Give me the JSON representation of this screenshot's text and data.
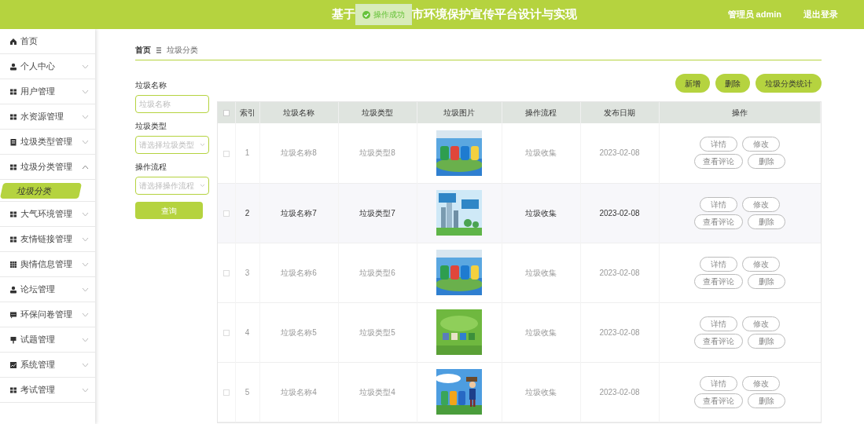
{
  "header": {
    "title_start": "基于",
    "toast": "操作成功",
    "title_end": "市环境保护宣传平台设计与实现",
    "user": "管理员 admin",
    "logout": "退出登录"
  },
  "sidebar": {
    "items": [
      {
        "label": "首页",
        "kind": "link"
      },
      {
        "label": "个人中心",
        "kind": "group",
        "expanded": false
      },
      {
        "label": "用户管理",
        "kind": "group",
        "expanded": false
      },
      {
        "label": "水资源管理",
        "kind": "group",
        "expanded": false
      },
      {
        "label": "垃圾类型管理",
        "kind": "group",
        "expanded": false
      },
      {
        "label": "垃圾分类管理",
        "kind": "group",
        "expanded": true,
        "children": [
          {
            "label": "垃圾分类",
            "selected": true
          }
        ]
      },
      {
        "label": "大气环境管理",
        "kind": "group",
        "expanded": false
      },
      {
        "label": "友情链接管理",
        "kind": "group",
        "expanded": false
      },
      {
        "label": "舆情信息管理",
        "kind": "group",
        "expanded": false
      },
      {
        "label": "论坛管理",
        "kind": "group",
        "expanded": false
      },
      {
        "label": "环保问卷管理",
        "kind": "group",
        "expanded": false
      },
      {
        "label": "试题管理",
        "kind": "group",
        "expanded": false
      },
      {
        "label": "系统管理",
        "kind": "group",
        "expanded": false
      },
      {
        "label": "考试管理",
        "kind": "group",
        "expanded": false
      }
    ]
  },
  "breadcrumb": [
    "首页",
    "垃圾分类"
  ],
  "filters": [
    {
      "label": "垃圾名称",
      "kind": "input",
      "placeholder": "垃圾名称"
    },
    {
      "label": "垃圾类型",
      "kind": "select",
      "placeholder": "请选择垃圾类型"
    },
    {
      "label": "操作流程",
      "kind": "select",
      "placeholder": "请选择操作流程"
    }
  ],
  "search_button": "查询",
  "actions": [
    "新增",
    "删除",
    "垃圾分类统计"
  ],
  "table": {
    "all_checked": false,
    "columns": [
      "索引",
      "垃圾名称",
      "垃圾类型",
      "垃圾图片",
      "操作流程",
      "发布日期",
      "操作"
    ],
    "rows": [
      {
        "checked": false,
        "highlighted": false,
        "index": "1",
        "name": "垃圾名称8",
        "type": "垃圾类型8",
        "process": "垃圾收集",
        "date": "2023-02-08",
        "ops": [
          "详情",
          "修改",
          "查看评论",
          "删除"
        ]
      },
      {
        "checked": false,
        "highlighted": true,
        "index": "2",
        "name": "垃圾名称7",
        "type": "垃圾类型7",
        "process": "垃圾收集",
        "date": "2023-02-08",
        "ops": [
          "详情",
          "修改",
          "查看评论",
          "删除"
        ]
      },
      {
        "checked": false,
        "highlighted": false,
        "index": "3",
        "name": "垃圾名称6",
        "type": "垃圾类型6",
        "process": "垃圾收集",
        "date": "2023-02-08",
        "ops": [
          "详情",
          "修改",
          "查看评论",
          "删除"
        ]
      },
      {
        "checked": false,
        "highlighted": false,
        "index": "4",
        "name": "垃圾名称5",
        "type": "垃圾类型5",
        "process": "垃圾收集",
        "date": "2023-02-08",
        "ops": [
          "详情",
          "修改",
          "查看评论",
          "删除"
        ]
      },
      {
        "checked": false,
        "highlighted": false,
        "index": "5",
        "name": "垃圾名称4",
        "type": "垃圾类型4",
        "process": "垃圾收集",
        "date": "2023-02-08",
        "ops": [
          "详情",
          "修改",
          "查看评论",
          "删除"
        ]
      }
    ]
  }
}
